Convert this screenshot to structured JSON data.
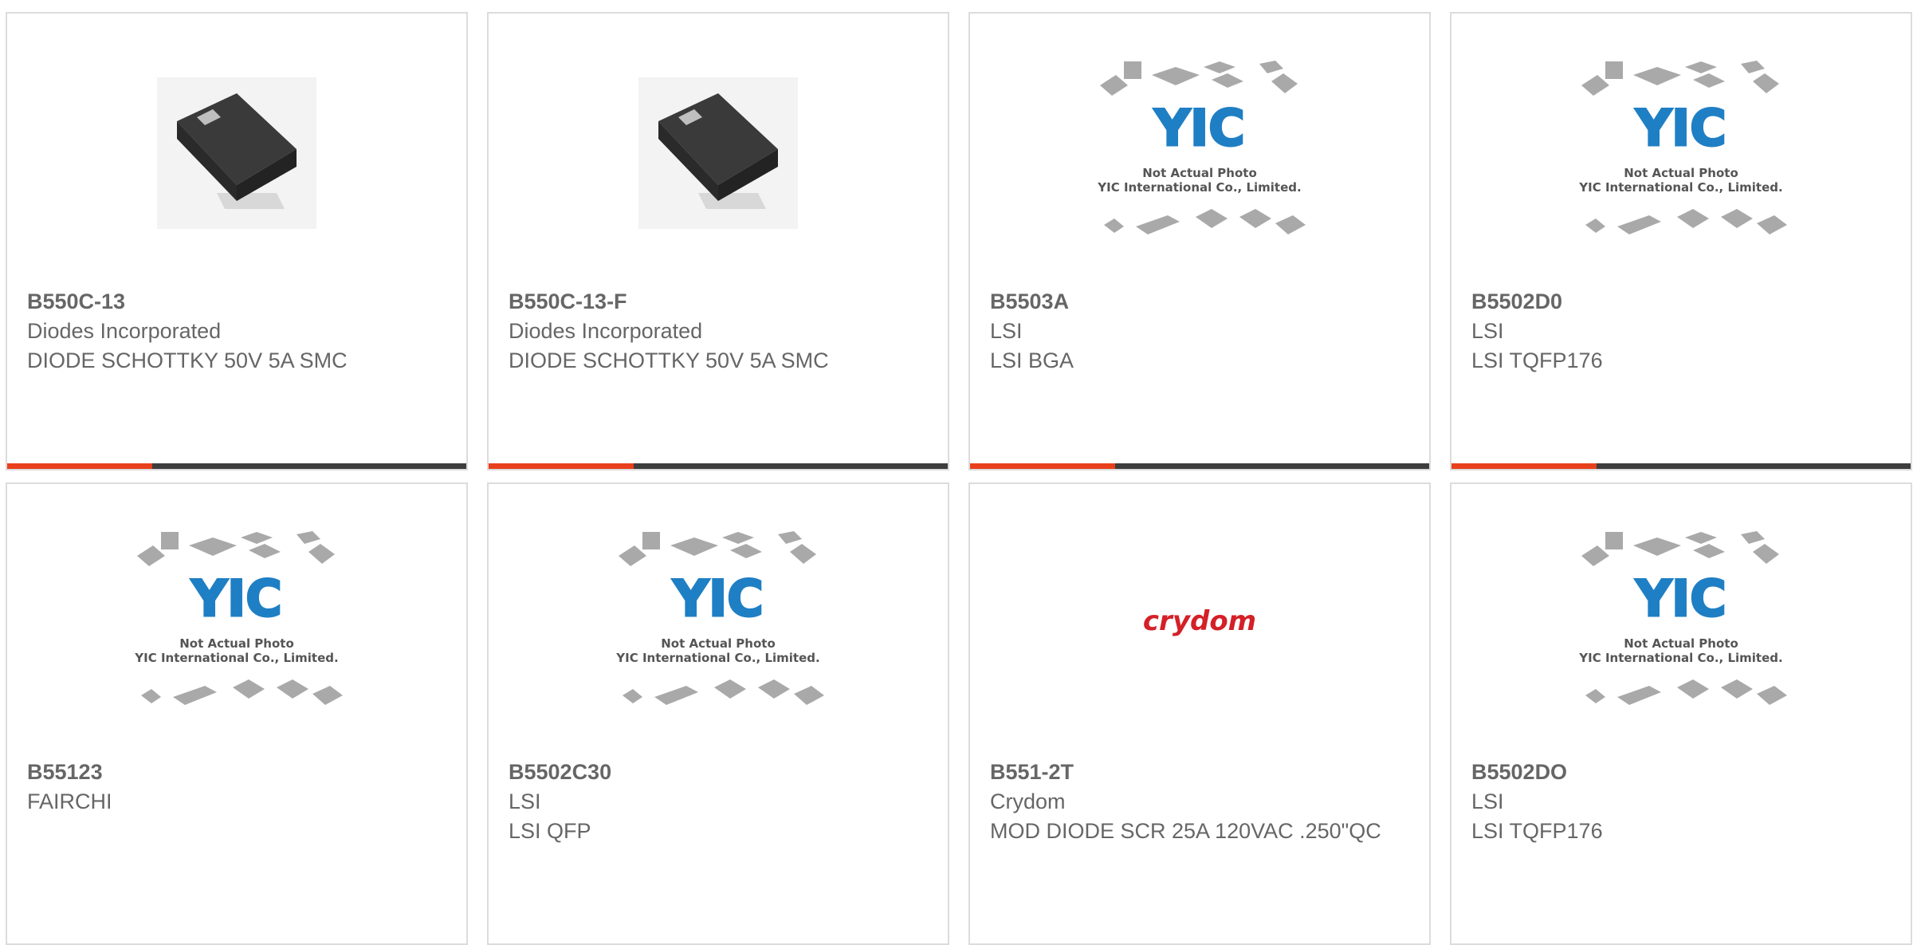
{
  "products": [
    {
      "part_number": "B550C-13",
      "manufacturer": "Diodes Incorporated",
      "description": "DIODE SCHOTTKY 50V 5A SMC",
      "image": "diode-smc-photo",
      "has_bar": true
    },
    {
      "part_number": "B550C-13-F",
      "manufacturer": "Diodes Incorporated",
      "description": "DIODE SCHOTTKY 50V 5A SMC",
      "image": "diode-smc-photo",
      "has_bar": true
    },
    {
      "part_number": "B5503A",
      "manufacturer": "LSI",
      "description": "LSI BGA",
      "image": "yic-placeholder",
      "has_bar": true
    },
    {
      "part_number": "B5502D0",
      "manufacturer": "LSI",
      "description": "LSI TQFP176",
      "image": "yic-placeholder",
      "has_bar": true
    },
    {
      "part_number": "B55123",
      "manufacturer": "FAIRCHI",
      "description": "",
      "image": "yic-placeholder",
      "has_bar": false
    },
    {
      "part_number": "B5502C30",
      "manufacturer": "LSI",
      "description": "LSI QFP",
      "image": "yic-placeholder",
      "has_bar": false
    },
    {
      "part_number": "B551-2T",
      "manufacturer": "Crydom",
      "description": "MOD DIODE SCR 25A 120VAC .250\"QC",
      "image": "crydom-logo",
      "has_bar": false
    },
    {
      "part_number": "B5502DO",
      "manufacturer": "LSI",
      "description": "LSI TQFP176",
      "image": "yic-placeholder",
      "has_bar": false
    }
  ],
  "placeholder": {
    "logo_text": "YIC",
    "line1": "Not Actual Photo",
    "line2": "YIC International Co., Limited."
  },
  "crydom_logo_text": "crydom",
  "colors": {
    "accent": "#e8401c",
    "bar": "#3d3d3d",
    "text": "#666666",
    "yic_blue": "#1f7fc4",
    "crydom_red": "#d42027"
  }
}
